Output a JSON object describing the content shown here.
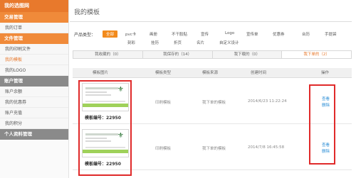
{
  "sidebar": {
    "top": "我的选图网",
    "sections": [
      {
        "header": "交易管理",
        "items": [
          "我的订单"
        ]
      },
      {
        "header": "文件管理",
        "items": [
          "我的印刷文件",
          "我的模板",
          "我的LOGO"
        ]
      },
      {
        "header": "账户管理",
        "items": [
          "账户余额",
          "我的优惠券",
          "账户充值",
          "我的积分"
        ]
      },
      {
        "header": "个人资料管理",
        "items": []
      }
    ],
    "active_item": "我的模板"
  },
  "page_title": "我的模板",
  "filters": {
    "label": "产品类型：",
    "options": [
      "全部",
      "pvc卡",
      "画册",
      "不干胶贴",
      "宣传",
      "Logo",
      "宣传单",
      "优惠券",
      "台历",
      "手提袋",
      "刻彩",
      "挂历",
      "折页",
      "名片",
      "自定义设计"
    ],
    "active": "全部"
  },
  "tabs": [
    {
      "label": "我收藏的（0）"
    },
    {
      "label": "我保存的（14）"
    },
    {
      "label": "我下载的（0）"
    },
    {
      "label": "我下单的（2）"
    }
  ],
  "active_tab": 3,
  "table": {
    "headers": [
      "模板图片",
      "模板类型",
      "模板来源",
      "创建时间",
      "操作"
    ],
    "rows": [
      {
        "code": "模板编号：22950",
        "type": "印刷模板",
        "source": "我下单的模板",
        "time": "2014/6/23 11:22:24",
        "actions": [
          "查看",
          "删除"
        ]
      },
      {
        "code": "模板编号：22950",
        "type": "印刷模板",
        "source": "我下单的模板",
        "time": "2014/7/8 16:45:58",
        "actions": [
          "查看",
          "删除"
        ]
      }
    ]
  },
  "thumb_logo_text": "⚜",
  "colors": {
    "accent": "#f28a1c",
    "link": "#2b8ed6",
    "highlight": "#e02a2a"
  }
}
